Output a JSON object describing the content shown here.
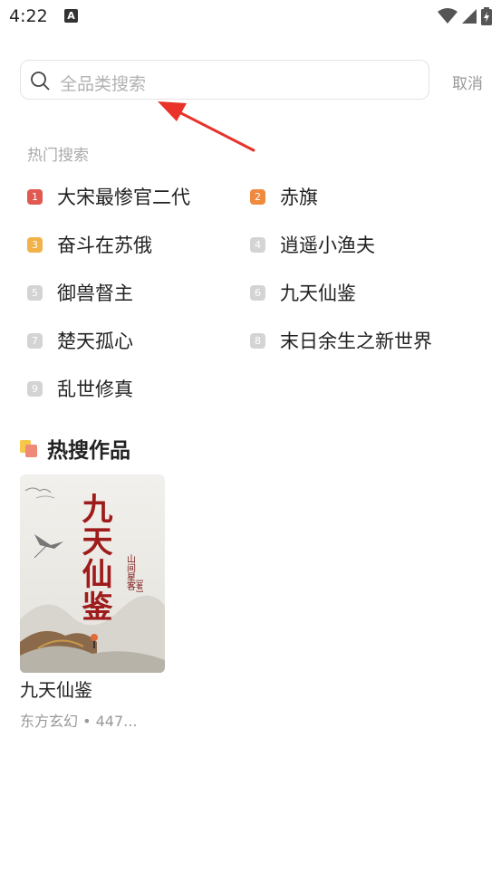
{
  "status_bar": {
    "time": "4:22",
    "notification_icon": "A"
  },
  "search": {
    "placeholder": "全品类搜索",
    "cancel_label": "取消"
  },
  "hot_search": {
    "title": "热门搜索",
    "items": [
      {
        "rank": "1",
        "label": "大宋最惨官二代",
        "color": "#e05a52"
      },
      {
        "rank": "2",
        "label": "赤旗",
        "color": "#f08a3e"
      },
      {
        "rank": "3",
        "label": "奋斗在苏俄",
        "color": "#f0b24a"
      },
      {
        "rank": "4",
        "label": "逍遥小渔夫",
        "color": "#d4d4d4"
      },
      {
        "rank": "5",
        "label": "御兽督主",
        "color": "#d4d4d4"
      },
      {
        "rank": "6",
        "label": "九天仙鉴",
        "color": "#d4d4d4"
      },
      {
        "rank": "7",
        "label": "楚天孤心",
        "color": "#d4d4d4"
      },
      {
        "rank": "8",
        "label": "末日余生之新世界",
        "color": "#d4d4d4"
      },
      {
        "rank": "9",
        "label": "乱世修真",
        "color": "#d4d4d4"
      }
    ]
  },
  "hot_works": {
    "title": "热搜作品",
    "books": [
      {
        "title": "九天仙鉴",
        "meta": "东方玄幻 • 447...",
        "cover_title": "九天仙鉴",
        "cover_author": "山间星客",
        "cover_author_suffix": "[著]"
      }
    ]
  }
}
